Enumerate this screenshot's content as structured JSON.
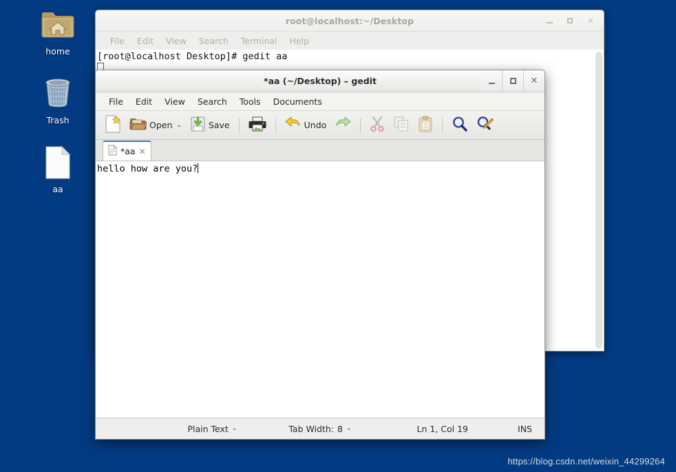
{
  "desktop": {
    "background_color": "#033b82",
    "icons": [
      {
        "name": "home-folder",
        "label": "home",
        "icon": "home-folder-icon"
      },
      {
        "name": "trash",
        "label": "Trash",
        "icon": "trash-bin-icon"
      },
      {
        "name": "aa-file",
        "label": "aa",
        "icon": "text-document-icon"
      }
    ]
  },
  "terminal": {
    "title": "root@localhost:~/Desktop",
    "active": false,
    "menus": [
      "File",
      "Edit",
      "View",
      "Search",
      "Terminal",
      "Help"
    ],
    "window_buttons": [
      "minimize",
      "maximize",
      "close"
    ],
    "content_line": "[root@localhost Desktop]# gedit aa"
  },
  "gedit": {
    "title": "*aa (~/Desktop) – gedit",
    "active": true,
    "menus": [
      "File",
      "Edit",
      "View",
      "Search",
      "Tools",
      "Documents"
    ],
    "window_buttons": [
      "minimize",
      "maximize",
      "close"
    ],
    "toolbar": {
      "new_label": "",
      "new_icon": "new-document-icon",
      "open_label": "Open",
      "open_icon": "open-folder-icon",
      "open_dropdown": "⌄",
      "save_label": "Save",
      "save_icon": "save-disk-icon",
      "print_icon": "printer-icon",
      "undo_label": "Undo",
      "undo_icon": "undo-arrow-icon",
      "redo_icon": "redo-arrow-icon",
      "cut_icon": "scissors-icon",
      "copy_icon": "copy-icon",
      "paste_icon": "clipboard-icon",
      "find_icon": "magnifier-icon",
      "replace_icon": "find-replace-icon"
    },
    "tab": {
      "label": "*aa",
      "close": "✕",
      "icon": "document-icon",
      "modified": true
    },
    "document_text": "hello how are you?",
    "statusbar": {
      "language": "Plain Text",
      "language_caret": "⌄",
      "tab_width_label": "Tab Width:",
      "tab_width_value": "8",
      "tab_width_caret": "⌄",
      "cursor_position": "Ln 1, Col 19",
      "insert_mode": "INS"
    }
  },
  "watermark": {
    "text": "https://blog.csdn.net/weixin_44299264"
  }
}
